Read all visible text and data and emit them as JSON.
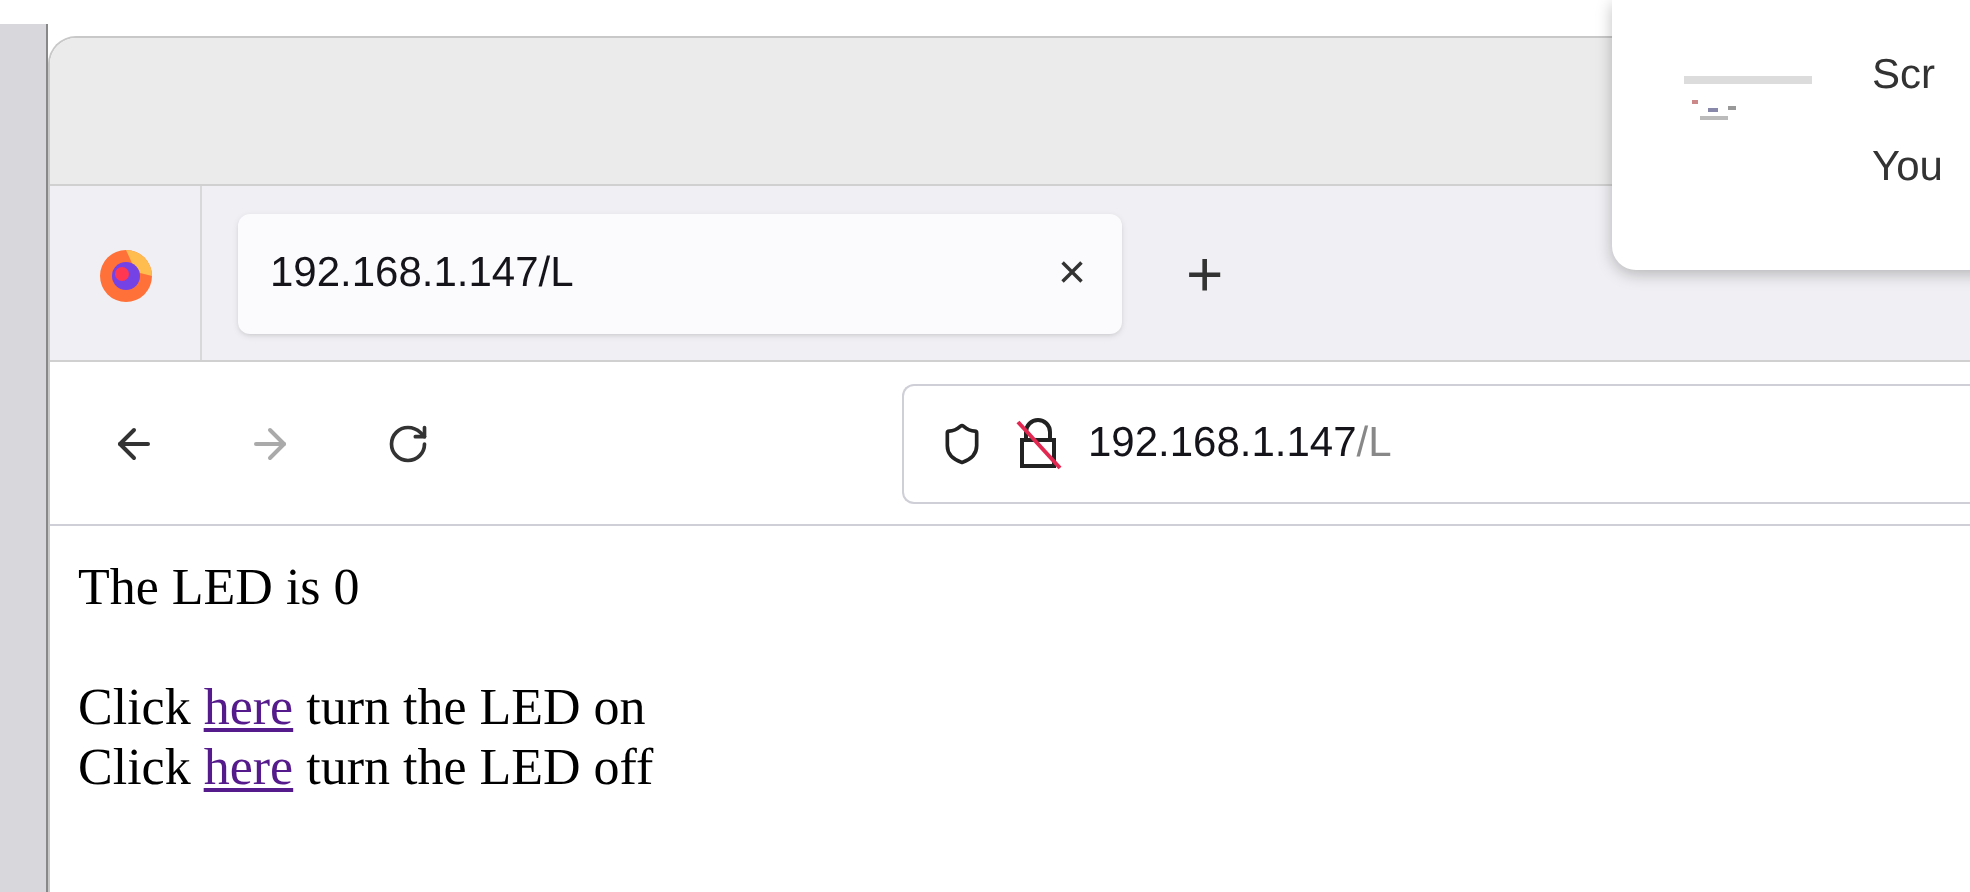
{
  "tab": {
    "title": "192.168.1.147/L",
    "close": "×",
    "new_tab": "+"
  },
  "address": {
    "host": "192.168.1.147",
    "path": "/L"
  },
  "notification": {
    "title": "Scr",
    "body": "You",
    "kind": "picture"
  },
  "page": {
    "status": "The LED is 0",
    "lines": [
      {
        "before": "Click ",
        "link": "here",
        "after": " turn the LED on"
      },
      {
        "before": "Click ",
        "link": "here",
        "after": " turn the LED off"
      }
    ]
  }
}
